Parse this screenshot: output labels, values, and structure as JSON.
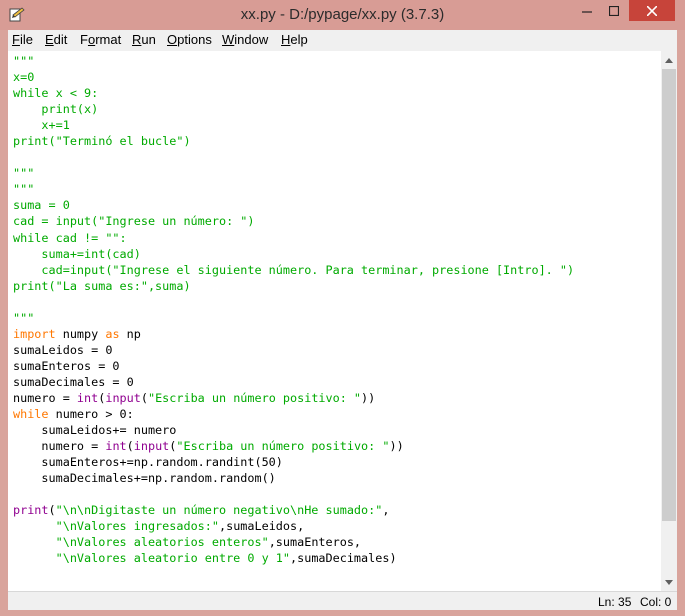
{
  "window": {
    "title": "xx.py - D:/pypage/xx.py (3.7.3)",
    "min_glyph": "—",
    "max_glyph": "☐",
    "close_glyph": "✕",
    "icon": "python-idle-icon"
  },
  "menubar": {
    "items": [
      {
        "u": "F",
        "rest": "ile"
      },
      {
        "u": "E",
        "rest": "dit"
      },
      {
        "pre": "F",
        "u": "o",
        "rest": "rmat"
      },
      {
        "u": "R",
        "rest": "un"
      },
      {
        "u": "O",
        "rest": "ptions"
      },
      {
        "u": "W",
        "rest": "indow"
      },
      {
        "u": "H",
        "rest": "elp"
      }
    ]
  },
  "editor": {
    "lines": [
      [
        [
          "st",
          "\"\"\""
        ]
      ],
      [
        [
          "st",
          "x=0"
        ]
      ],
      [
        [
          "st",
          "while x < 9:"
        ]
      ],
      [
        [
          "st",
          "    print(x)"
        ]
      ],
      [
        [
          "st",
          "    x+=1"
        ]
      ],
      [
        [
          "st",
          "print(\"Terminó el bucle\")"
        ]
      ],
      [],
      [
        [
          "st",
          "\"\"\""
        ]
      ],
      [
        [
          "st",
          "\"\"\""
        ]
      ],
      [
        [
          "st",
          "suma = 0"
        ]
      ],
      [
        [
          "st",
          "cad = input(\"Ingrese un número: \")"
        ]
      ],
      [
        [
          "st",
          "while cad != \"\":"
        ]
      ],
      [
        [
          "st",
          "    suma+=int(cad)"
        ]
      ],
      [
        [
          "st",
          "    cad=input(\"Ingrese el siguiente número. Para terminar, presione [Intro]. \")"
        ]
      ],
      [
        [
          "st",
          "print(\"La suma es:\",suma)"
        ]
      ],
      [],
      [
        [
          "st",
          "\"\"\""
        ]
      ],
      [
        [
          "kw",
          "import"
        ],
        [
          "",
          " numpy "
        ],
        [
          "kw",
          "as"
        ],
        [
          "",
          " np"
        ]
      ],
      [
        [
          "",
          "sumaLeidos = 0"
        ]
      ],
      [
        [
          "",
          "sumaEnteros = 0"
        ]
      ],
      [
        [
          "",
          "sumaDecimales = 0"
        ]
      ],
      [
        [
          "",
          "numero = "
        ],
        [
          "bi",
          "int"
        ],
        [
          "",
          "("
        ],
        [
          "bi",
          "input"
        ],
        [
          "",
          "("
        ],
        [
          "st",
          "\"Escriba un número positivo: \""
        ],
        [
          "",
          "))"
        ]
      ],
      [
        [
          "kw",
          "while"
        ],
        [
          "",
          " numero > 0:"
        ]
      ],
      [
        [
          "",
          "    sumaLeidos+= numero"
        ]
      ],
      [
        [
          "",
          "    numero = "
        ],
        [
          "bi",
          "int"
        ],
        [
          "",
          "("
        ],
        [
          "bi",
          "input"
        ],
        [
          "",
          "("
        ],
        [
          "st",
          "\"Escriba un número positivo: \""
        ],
        [
          "",
          "))"
        ]
      ],
      [
        [
          "",
          "    sumaEnteros+=np.random.randint(50)"
        ]
      ],
      [
        [
          "",
          "    sumaDecimales+=np.random.random()"
        ]
      ],
      [],
      [
        [
          "bi",
          "print"
        ],
        [
          "",
          "("
        ],
        [
          "st",
          "\"\\n\\nDigitaste un número negativo\\nHe sumado:\""
        ],
        [
          "",
          ","
        ]
      ],
      [
        [
          "",
          "      "
        ],
        [
          "st",
          "\"\\nValores ingresados:\""
        ],
        [
          "",
          ",sumaLeidos,"
        ]
      ],
      [
        [
          "",
          "      "
        ],
        [
          "st",
          "\"\\nValores aleatorios enteros\""
        ],
        [
          "",
          ",sumaEnteros,"
        ]
      ],
      [
        [
          "",
          "      "
        ],
        [
          "st",
          "\"\\nValores aleatorio entre 0 y 1\""
        ],
        [
          "",
          ",sumaDecimales)"
        ]
      ]
    ]
  },
  "scrollbar": {
    "up": "▲",
    "down": "▼"
  },
  "statusbar": {
    "line": "Ln: 35",
    "col": "Col: 0"
  }
}
